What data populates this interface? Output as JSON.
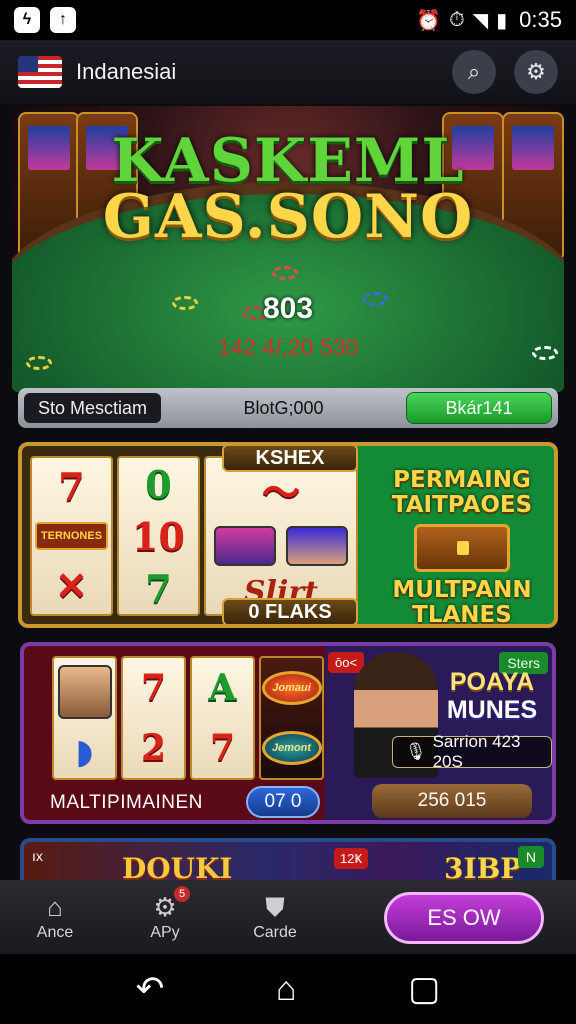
{
  "status_bar": {
    "time": "0:35"
  },
  "header": {
    "title": "Indanesiai"
  },
  "hero": {
    "title_line1": "KASKEML",
    "title_line2": "GAS.SONO",
    "table_number": "803",
    "sub_number": "142 4/,20 530"
  },
  "info_bar": {
    "left_label": "Sto Mesctiam",
    "mid_label": "BlotG;000",
    "button_label": "Bkár141"
  },
  "slot1": {
    "top_plate": "KSHEX",
    "bottom_plate": "0 FLAKS",
    "badge": "TERNONES",
    "reel_word": "Slirt",
    "right_line1": "PERMAING TAITPAOES",
    "right_line2": "MULTPANN TLANES"
  },
  "slot2": {
    "tag_left": "ōo<",
    "tag_right": "Sters",
    "title_l1": "POAYA",
    "title_l2": "MUNES",
    "session": "Sarrion 423 20S",
    "label": "MALTIPIMAINEN",
    "pill_blue": "07 0",
    "pill_bronze": "256 015",
    "wheel1": "Jomaui",
    "wheel2": "Jemont"
  },
  "slot3": {
    "tag_left": "ıx",
    "text_left": "DOUKI",
    "tag_mid": "12Ҝ",
    "text_right": "3IBP",
    "tag_right": "N"
  },
  "bottom_nav": {
    "items": [
      {
        "label": "Ance",
        "icon": "home-icon"
      },
      {
        "label": "APy",
        "icon": "gear-icon",
        "badge": "5"
      },
      {
        "label": "Carde",
        "icon": "shield-icon"
      }
    ],
    "cta_label": "ES OW"
  }
}
